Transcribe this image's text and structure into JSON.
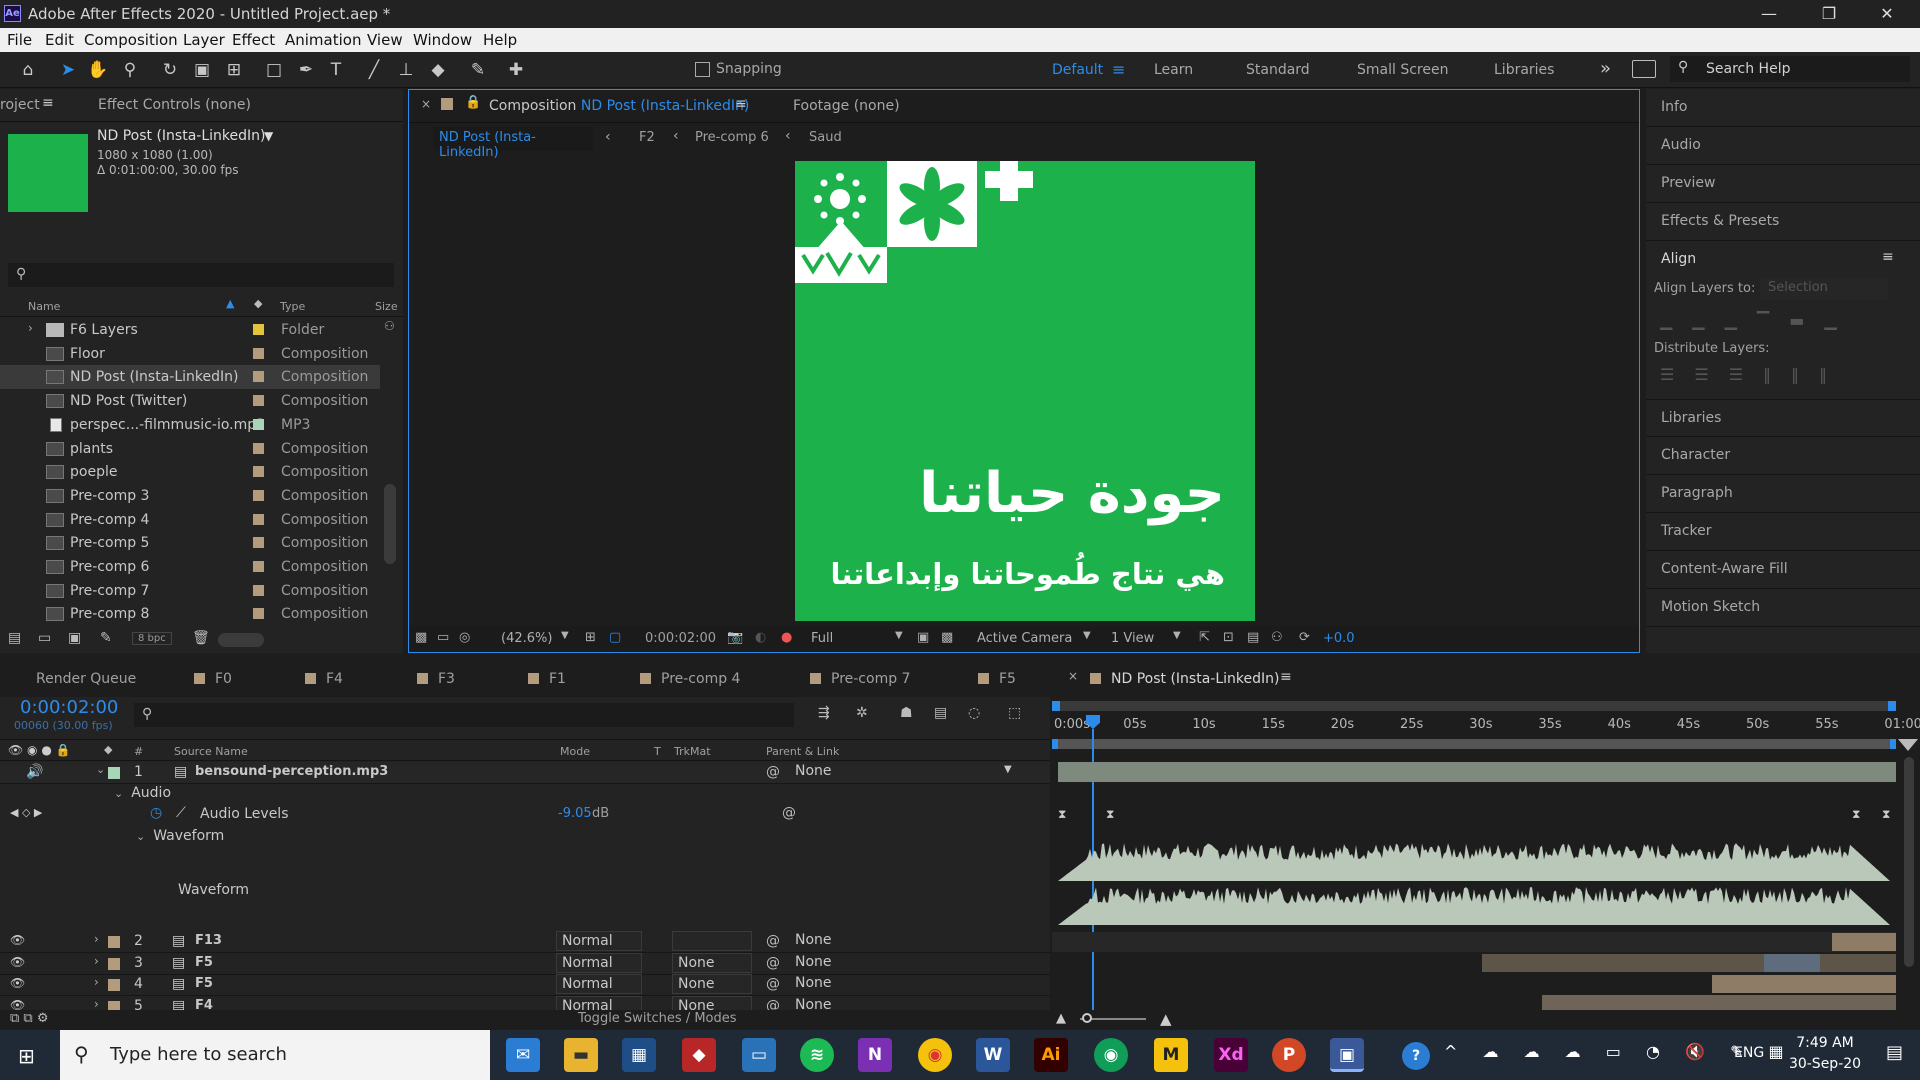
{
  "window": {
    "title": "Adobe After Effects 2020 - Untitled Project.aep *",
    "app_badge": "Ae",
    "minimize": "—",
    "restore": "❐",
    "close": "✕"
  },
  "menu": [
    "File",
    "Edit",
    "Composition",
    "Layer",
    "Effect",
    "Animation",
    "View",
    "Window",
    "Help"
  ],
  "toolbar": {
    "snapping": "Snapping",
    "workspaces": [
      "Default",
      "Learn",
      "Standard",
      "Small Screen",
      "Libraries"
    ],
    "more": "»",
    "search_placeholder": "Search Help"
  },
  "project": {
    "tab": "roject",
    "effect_controls": "Effect Controls (none)",
    "selected": {
      "name": "ND Post (Insta-LinkedIn)",
      "dims": "1080 x 1080 (1.00)",
      "duration": "Δ 0:01:00:00, 30.00 fps",
      "swatch": "#1db14b"
    },
    "columns": {
      "name": "Name",
      "type": "Type",
      "size": "Size"
    },
    "items": [
      {
        "name": "F6 Layers",
        "type": "Folder",
        "color": "#e2c53a"
      },
      {
        "name": "Floor",
        "type": "Composition",
        "color": "#b39b7e"
      },
      {
        "name": "ND Post (Insta-LinkedIn)",
        "type": "Composition",
        "color": "#b39b7e"
      },
      {
        "name": "ND Post (Twitter)",
        "type": "Composition",
        "color": "#b39b7e"
      },
      {
        "name": "perspec...-filmmusic-io.mp3",
        "type": "MP3",
        "color": "#a8d4b8"
      },
      {
        "name": "plants",
        "type": "Composition",
        "color": "#b39b7e"
      },
      {
        "name": "poeple",
        "type": "Composition",
        "color": "#b39b7e"
      },
      {
        "name": "Pre-comp 3",
        "type": "Composition",
        "color": "#b39b7e"
      },
      {
        "name": "Pre-comp 4",
        "type": "Composition",
        "color": "#b39b7e"
      },
      {
        "name": "Pre-comp 5",
        "type": "Composition",
        "color": "#b39b7e"
      },
      {
        "name": "Pre-comp 6",
        "type": "Composition",
        "color": "#b39b7e"
      },
      {
        "name": "Pre-comp 7",
        "type": "Composition",
        "color": "#b39b7e"
      },
      {
        "name": "Pre-comp 8",
        "type": "Composition",
        "color": "#b39b7e"
      }
    ],
    "bpc": "8 bpc"
  },
  "comp": {
    "tab_prefix": "Composition",
    "tab_name": "ND Post (Insta-LinkedIn)",
    "footage": "Footage (none)",
    "breadcrumbs": [
      "ND Post (Insta-LinkedIn)",
      "F2",
      "Pre-comp 6",
      "Saud"
    ],
    "title_ar": "جودة حياتنا",
    "subtitle_ar": "هي نتاج طُموحاتنا وإبداعاتنا",
    "bg": "#1db14b",
    "zoom": "(42.6%)",
    "timecode": "0:00:02:00",
    "resolution": "Full",
    "camera": "Active Camera",
    "views": "1 View",
    "exposure": "+0.0"
  },
  "right_panels": [
    "Info",
    "Audio",
    "Preview",
    "Effects & Presets"
  ],
  "align": {
    "title": "Align",
    "align_to_label": "Align Layers to:",
    "align_to_value": "Selection",
    "distribute": "Distribute Layers:"
  },
  "right_panels_bottom": [
    "Libraries",
    "Character",
    "Paragraph",
    "Tracker",
    "Content-Aware Fill",
    "Motion Sketch"
  ],
  "timeline": {
    "tabs": [
      "F0",
      "F4",
      "F3",
      "F1",
      "Pre-comp 4",
      "Pre-comp 7",
      "F5"
    ],
    "render_queue": "Render Queue",
    "active_tab": "ND Post (Insta-LinkedIn)",
    "timecode": "0:00:02:00",
    "frames": "00060 (30.00 fps)",
    "columns": {
      "num": "#",
      "source": "Source Name",
      "mode": "Mode",
      "t": "T",
      "trkmat": "TrkMat",
      "parent": "Parent & Link"
    },
    "audio_layer": {
      "num": "1",
      "name": "bensound-perception.mp3",
      "parent": "None",
      "audio": "Audio",
      "levels_label": "Audio Levels",
      "levels_value": "-9.05",
      "levels_unit": "dB",
      "waveform": "Waveform",
      "waveform2": "Waveform"
    },
    "layers": [
      {
        "num": "2",
        "name": "F13",
        "mode": "Normal",
        "trkmat": "",
        "parent": "None",
        "color": "#b39b7e"
      },
      {
        "num": "3",
        "name": "F5",
        "mode": "Normal",
        "trkmat": "None",
        "parent": "None",
        "color": "#b39b7e"
      },
      {
        "num": "4",
        "name": "F5",
        "mode": "Normal",
        "trkmat": "None",
        "parent": "None",
        "color": "#b39b7e"
      },
      {
        "num": "5",
        "name": "F4",
        "mode": "Normal",
        "trkmat": "None",
        "parent": "None",
        "color": "#b39b7e"
      }
    ],
    "ruler": [
      "0:00s",
      "05s",
      "10s",
      "15s",
      "20s",
      "25s",
      "30s",
      "35s",
      "40s",
      "45s",
      "50s",
      "55s",
      "01:00"
    ],
    "toggle": "Toggle Switches / Modes"
  },
  "taskbar": {
    "search": "Type here to search",
    "lang": "ENG",
    "time": "7:49 AM",
    "date": "30-Sep-20"
  }
}
